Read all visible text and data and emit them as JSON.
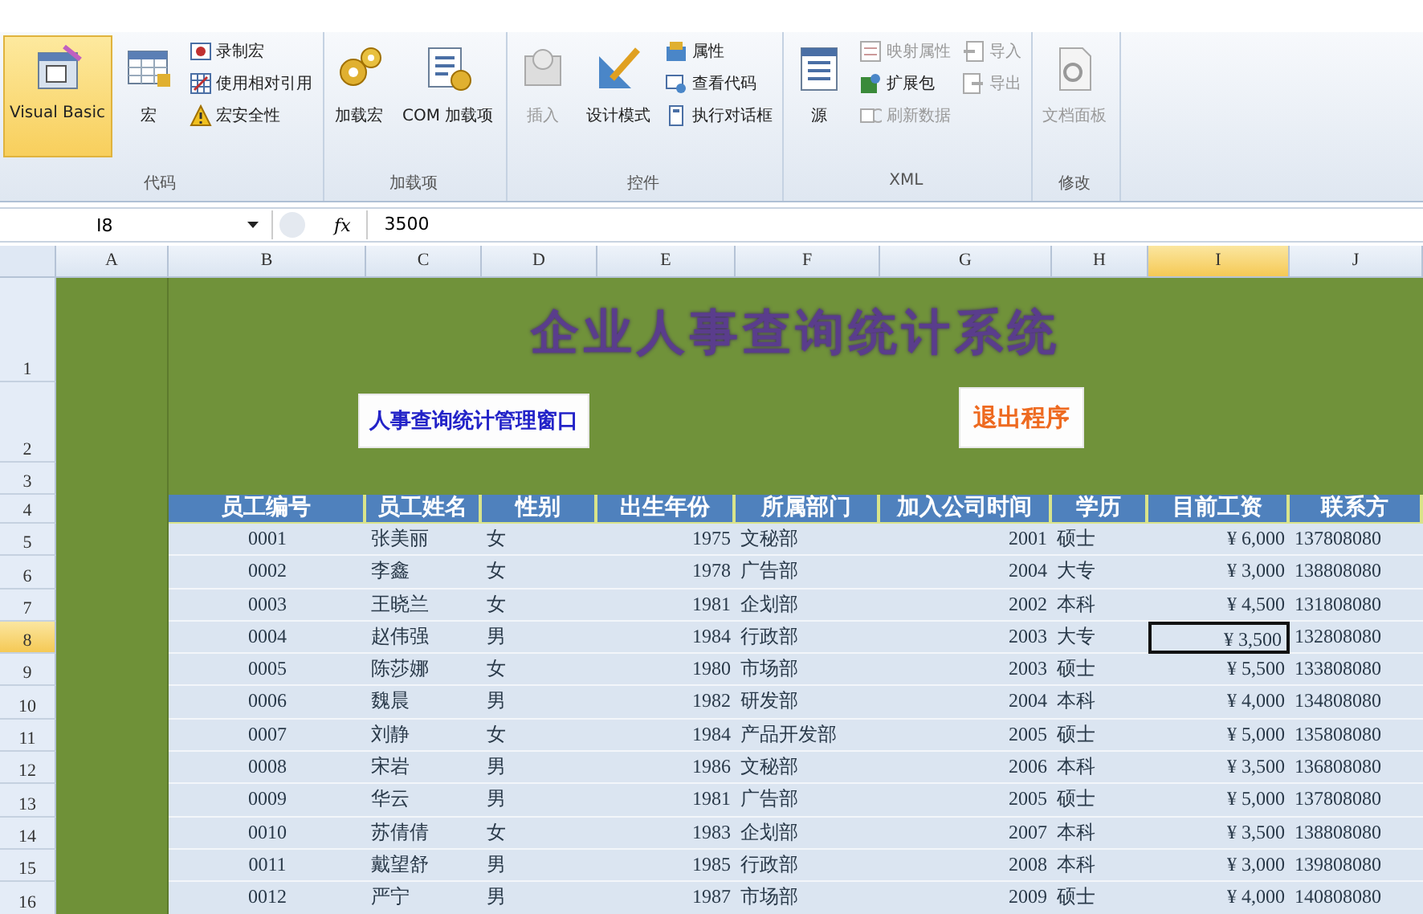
{
  "ribbon": {
    "groups": [
      {
        "label": "代码",
        "items": [
          {
            "label": "Visual Basic",
            "kind": "large",
            "selected": true,
            "disabled": false
          },
          {
            "label": "宏",
            "kind": "large",
            "selected": false,
            "disabled": false
          },
          {
            "label": "录制宏",
            "kind": "small",
            "selected": false,
            "disabled": false
          },
          {
            "label": "使用相对引用",
            "kind": "small",
            "selected": false,
            "disabled": false
          },
          {
            "label": "宏安全性",
            "kind": "small",
            "selected": false,
            "disabled": false
          }
        ]
      },
      {
        "label": "加载项",
        "items": [
          {
            "label": "加载宏",
            "kind": "large",
            "selected": false,
            "disabled": false
          },
          {
            "label": "COM 加载项",
            "kind": "large",
            "selected": false,
            "disabled": false
          }
        ]
      },
      {
        "label": "控件",
        "items": [
          {
            "label": "插入",
            "kind": "large",
            "selected": false,
            "disabled": true
          },
          {
            "label": "设计模式",
            "kind": "large",
            "selected": false,
            "disabled": false
          },
          {
            "label": "属性",
            "kind": "small",
            "selected": false,
            "disabled": false
          },
          {
            "label": "查看代码",
            "kind": "small",
            "selected": false,
            "disabled": false
          },
          {
            "label": "执行对话框",
            "kind": "small",
            "selected": false,
            "disabled": false
          }
        ]
      },
      {
        "label": "XML",
        "items": [
          {
            "label": "源",
            "kind": "large",
            "selected": false,
            "disabled": false
          },
          {
            "label": "映射属性",
            "kind": "small",
            "selected": false,
            "disabled": true
          },
          {
            "label": "扩展包",
            "kind": "small",
            "selected": false,
            "disabled": false
          },
          {
            "label": "刷新数据",
            "kind": "small",
            "selected": false,
            "disabled": true
          },
          {
            "label": "导入",
            "kind": "small",
            "selected": false,
            "disabled": true
          },
          {
            "label": "导出",
            "kind": "small",
            "selected": false,
            "disabled": true
          }
        ]
      },
      {
        "label": "修改",
        "items": [
          {
            "label": "文档面板",
            "kind": "large",
            "selected": false,
            "disabled": true
          }
        ]
      }
    ]
  },
  "formula_bar": {
    "name_box": "I8",
    "function_label": "fx",
    "formula": "3500"
  },
  "columns": [
    {
      "label": "A",
      "selected": false
    },
    {
      "label": "B",
      "selected": false
    },
    {
      "label": "C",
      "selected": false
    },
    {
      "label": "D",
      "selected": false
    },
    {
      "label": "E",
      "selected": false
    },
    {
      "label": "F",
      "selected": false
    },
    {
      "label": "G",
      "selected": false
    },
    {
      "label": "H",
      "selected": false
    },
    {
      "label": "I",
      "selected": true
    },
    {
      "label": "J",
      "selected": false
    }
  ],
  "row_numbers": [
    {
      "label": "1",
      "selected": false
    },
    {
      "label": "2",
      "selected": false
    },
    {
      "label": "3",
      "selected": false
    },
    {
      "label": "4",
      "selected": false
    },
    {
      "label": "5",
      "selected": false
    },
    {
      "label": "6",
      "selected": false
    },
    {
      "label": "7",
      "selected": false
    },
    {
      "label": "8",
      "selected": true
    },
    {
      "label": "9",
      "selected": false
    },
    {
      "label": "10",
      "selected": false
    },
    {
      "label": "11",
      "selected": false
    },
    {
      "label": "12",
      "selected": false
    },
    {
      "label": "13",
      "selected": false
    },
    {
      "label": "14",
      "selected": false
    },
    {
      "label": "15",
      "selected": false
    },
    {
      "label": "16",
      "selected": false
    }
  ],
  "banner": {
    "title": "企业人事查询统计系统",
    "buttons": [
      {
        "label": "人事查询统计管理窗口",
        "kind": "open"
      },
      {
        "label": "退出程序",
        "kind": "exit"
      }
    ]
  },
  "table": {
    "columns": [
      "员工编号",
      "员工姓名",
      "性别",
      "出生年份",
      "所属部门",
      "加入公司时间",
      "学历",
      "目前工资",
      "联系方"
    ],
    "rows": [
      {
        "cells": [
          {
            "text": "0001",
            "selected": false
          },
          {
            "text": "张美丽",
            "selected": false
          },
          {
            "text": "女",
            "selected": false
          },
          {
            "text": "1975",
            "selected": false
          },
          {
            "text": "文秘部",
            "selected": false
          },
          {
            "text": "2001",
            "selected": false
          },
          {
            "text": "硕士",
            "selected": false
          },
          {
            "text": "¥ 6,000",
            "selected": false
          },
          {
            "text": "137808080",
            "selected": false
          }
        ]
      },
      {
        "cells": [
          {
            "text": "0002",
            "selected": false
          },
          {
            "text": "李鑫",
            "selected": false
          },
          {
            "text": "女",
            "selected": false
          },
          {
            "text": "1978",
            "selected": false
          },
          {
            "text": "广告部",
            "selected": false
          },
          {
            "text": "2004",
            "selected": false
          },
          {
            "text": "大专",
            "selected": false
          },
          {
            "text": "¥ 3,000",
            "selected": false
          },
          {
            "text": "138808080",
            "selected": false
          }
        ]
      },
      {
        "cells": [
          {
            "text": "0003",
            "selected": false
          },
          {
            "text": "王晓兰",
            "selected": false
          },
          {
            "text": "女",
            "selected": false
          },
          {
            "text": "1981",
            "selected": false
          },
          {
            "text": "企划部",
            "selected": false
          },
          {
            "text": "2002",
            "selected": false
          },
          {
            "text": "本科",
            "selected": false
          },
          {
            "text": "¥ 4,500",
            "selected": false
          },
          {
            "text": "131808080",
            "selected": false
          }
        ]
      },
      {
        "cells": [
          {
            "text": "0004",
            "selected": false
          },
          {
            "text": "赵伟强",
            "selected": false
          },
          {
            "text": "男",
            "selected": false
          },
          {
            "text": "1984",
            "selected": false
          },
          {
            "text": "行政部",
            "selected": false
          },
          {
            "text": "2003",
            "selected": false
          },
          {
            "text": "大专",
            "selected": false
          },
          {
            "text": "¥ 3,500",
            "selected": true
          },
          {
            "text": "132808080",
            "selected": false
          }
        ]
      },
      {
        "cells": [
          {
            "text": "0005",
            "selected": false
          },
          {
            "text": "陈莎娜",
            "selected": false
          },
          {
            "text": "女",
            "selected": false
          },
          {
            "text": "1980",
            "selected": false
          },
          {
            "text": "市场部",
            "selected": false
          },
          {
            "text": "2003",
            "selected": false
          },
          {
            "text": "硕士",
            "selected": false
          },
          {
            "text": "¥ 5,500",
            "selected": false
          },
          {
            "text": "133808080",
            "selected": false
          }
        ]
      },
      {
        "cells": [
          {
            "text": "0006",
            "selected": false
          },
          {
            "text": "魏晨",
            "selected": false
          },
          {
            "text": "男",
            "selected": false
          },
          {
            "text": "1982",
            "selected": false
          },
          {
            "text": "研发部",
            "selected": false
          },
          {
            "text": "2004",
            "selected": false
          },
          {
            "text": "本科",
            "selected": false
          },
          {
            "text": "¥ 4,000",
            "selected": false
          },
          {
            "text": "134808080",
            "selected": false
          }
        ]
      },
      {
        "cells": [
          {
            "text": "0007",
            "selected": false
          },
          {
            "text": "刘静",
            "selected": false
          },
          {
            "text": "女",
            "selected": false
          },
          {
            "text": "1984",
            "selected": false
          },
          {
            "text": "产品开发部",
            "selected": false
          },
          {
            "text": "2005",
            "selected": false
          },
          {
            "text": "硕士",
            "selected": false
          },
          {
            "text": "¥ 5,000",
            "selected": false
          },
          {
            "text": "135808080",
            "selected": false
          }
        ]
      },
      {
        "cells": [
          {
            "text": "0008",
            "selected": false
          },
          {
            "text": "宋岩",
            "selected": false
          },
          {
            "text": "男",
            "selected": false
          },
          {
            "text": "1986",
            "selected": false
          },
          {
            "text": "文秘部",
            "selected": false
          },
          {
            "text": "2006",
            "selected": false
          },
          {
            "text": "本科",
            "selected": false
          },
          {
            "text": "¥ 3,500",
            "selected": false
          },
          {
            "text": "136808080",
            "selected": false
          }
        ]
      },
      {
        "cells": [
          {
            "text": "0009",
            "selected": false
          },
          {
            "text": "华云",
            "selected": false
          },
          {
            "text": "男",
            "selected": false
          },
          {
            "text": "1981",
            "selected": false
          },
          {
            "text": "广告部",
            "selected": false
          },
          {
            "text": "2005",
            "selected": false
          },
          {
            "text": "硕士",
            "selected": false
          },
          {
            "text": "¥ 5,000",
            "selected": false
          },
          {
            "text": "137808080",
            "selected": false
          }
        ]
      },
      {
        "cells": [
          {
            "text": "0010",
            "selected": false
          },
          {
            "text": "苏倩倩",
            "selected": false
          },
          {
            "text": "女",
            "selected": false
          },
          {
            "text": "1983",
            "selected": false
          },
          {
            "text": "企划部",
            "selected": false
          },
          {
            "text": "2007",
            "selected": false
          },
          {
            "text": "本科",
            "selected": false
          },
          {
            "text": "¥ 3,500",
            "selected": false
          },
          {
            "text": "138808080",
            "selected": false
          }
        ]
      },
      {
        "cells": [
          {
            "text": "0011",
            "selected": false
          },
          {
            "text": "戴望舒",
            "selected": false
          },
          {
            "text": "男",
            "selected": false
          },
          {
            "text": "1985",
            "selected": false
          },
          {
            "text": "行政部",
            "selected": false
          },
          {
            "text": "2008",
            "selected": false
          },
          {
            "text": "本科",
            "selected": false
          },
          {
            "text": "¥ 3,000",
            "selected": false
          },
          {
            "text": "139808080",
            "selected": false
          }
        ]
      },
      {
        "cells": [
          {
            "text": "0012",
            "selected": false
          },
          {
            "text": "严宁",
            "selected": false
          },
          {
            "text": "男",
            "selected": false
          },
          {
            "text": "1987",
            "selected": false
          },
          {
            "text": "市场部",
            "selected": false
          },
          {
            "text": "2009",
            "selected": false
          },
          {
            "text": "硕士",
            "selected": false
          },
          {
            "text": "¥ 4,000",
            "selected": false
          },
          {
            "text": "140808080",
            "selected": false
          }
        ]
      }
    ]
  }
}
